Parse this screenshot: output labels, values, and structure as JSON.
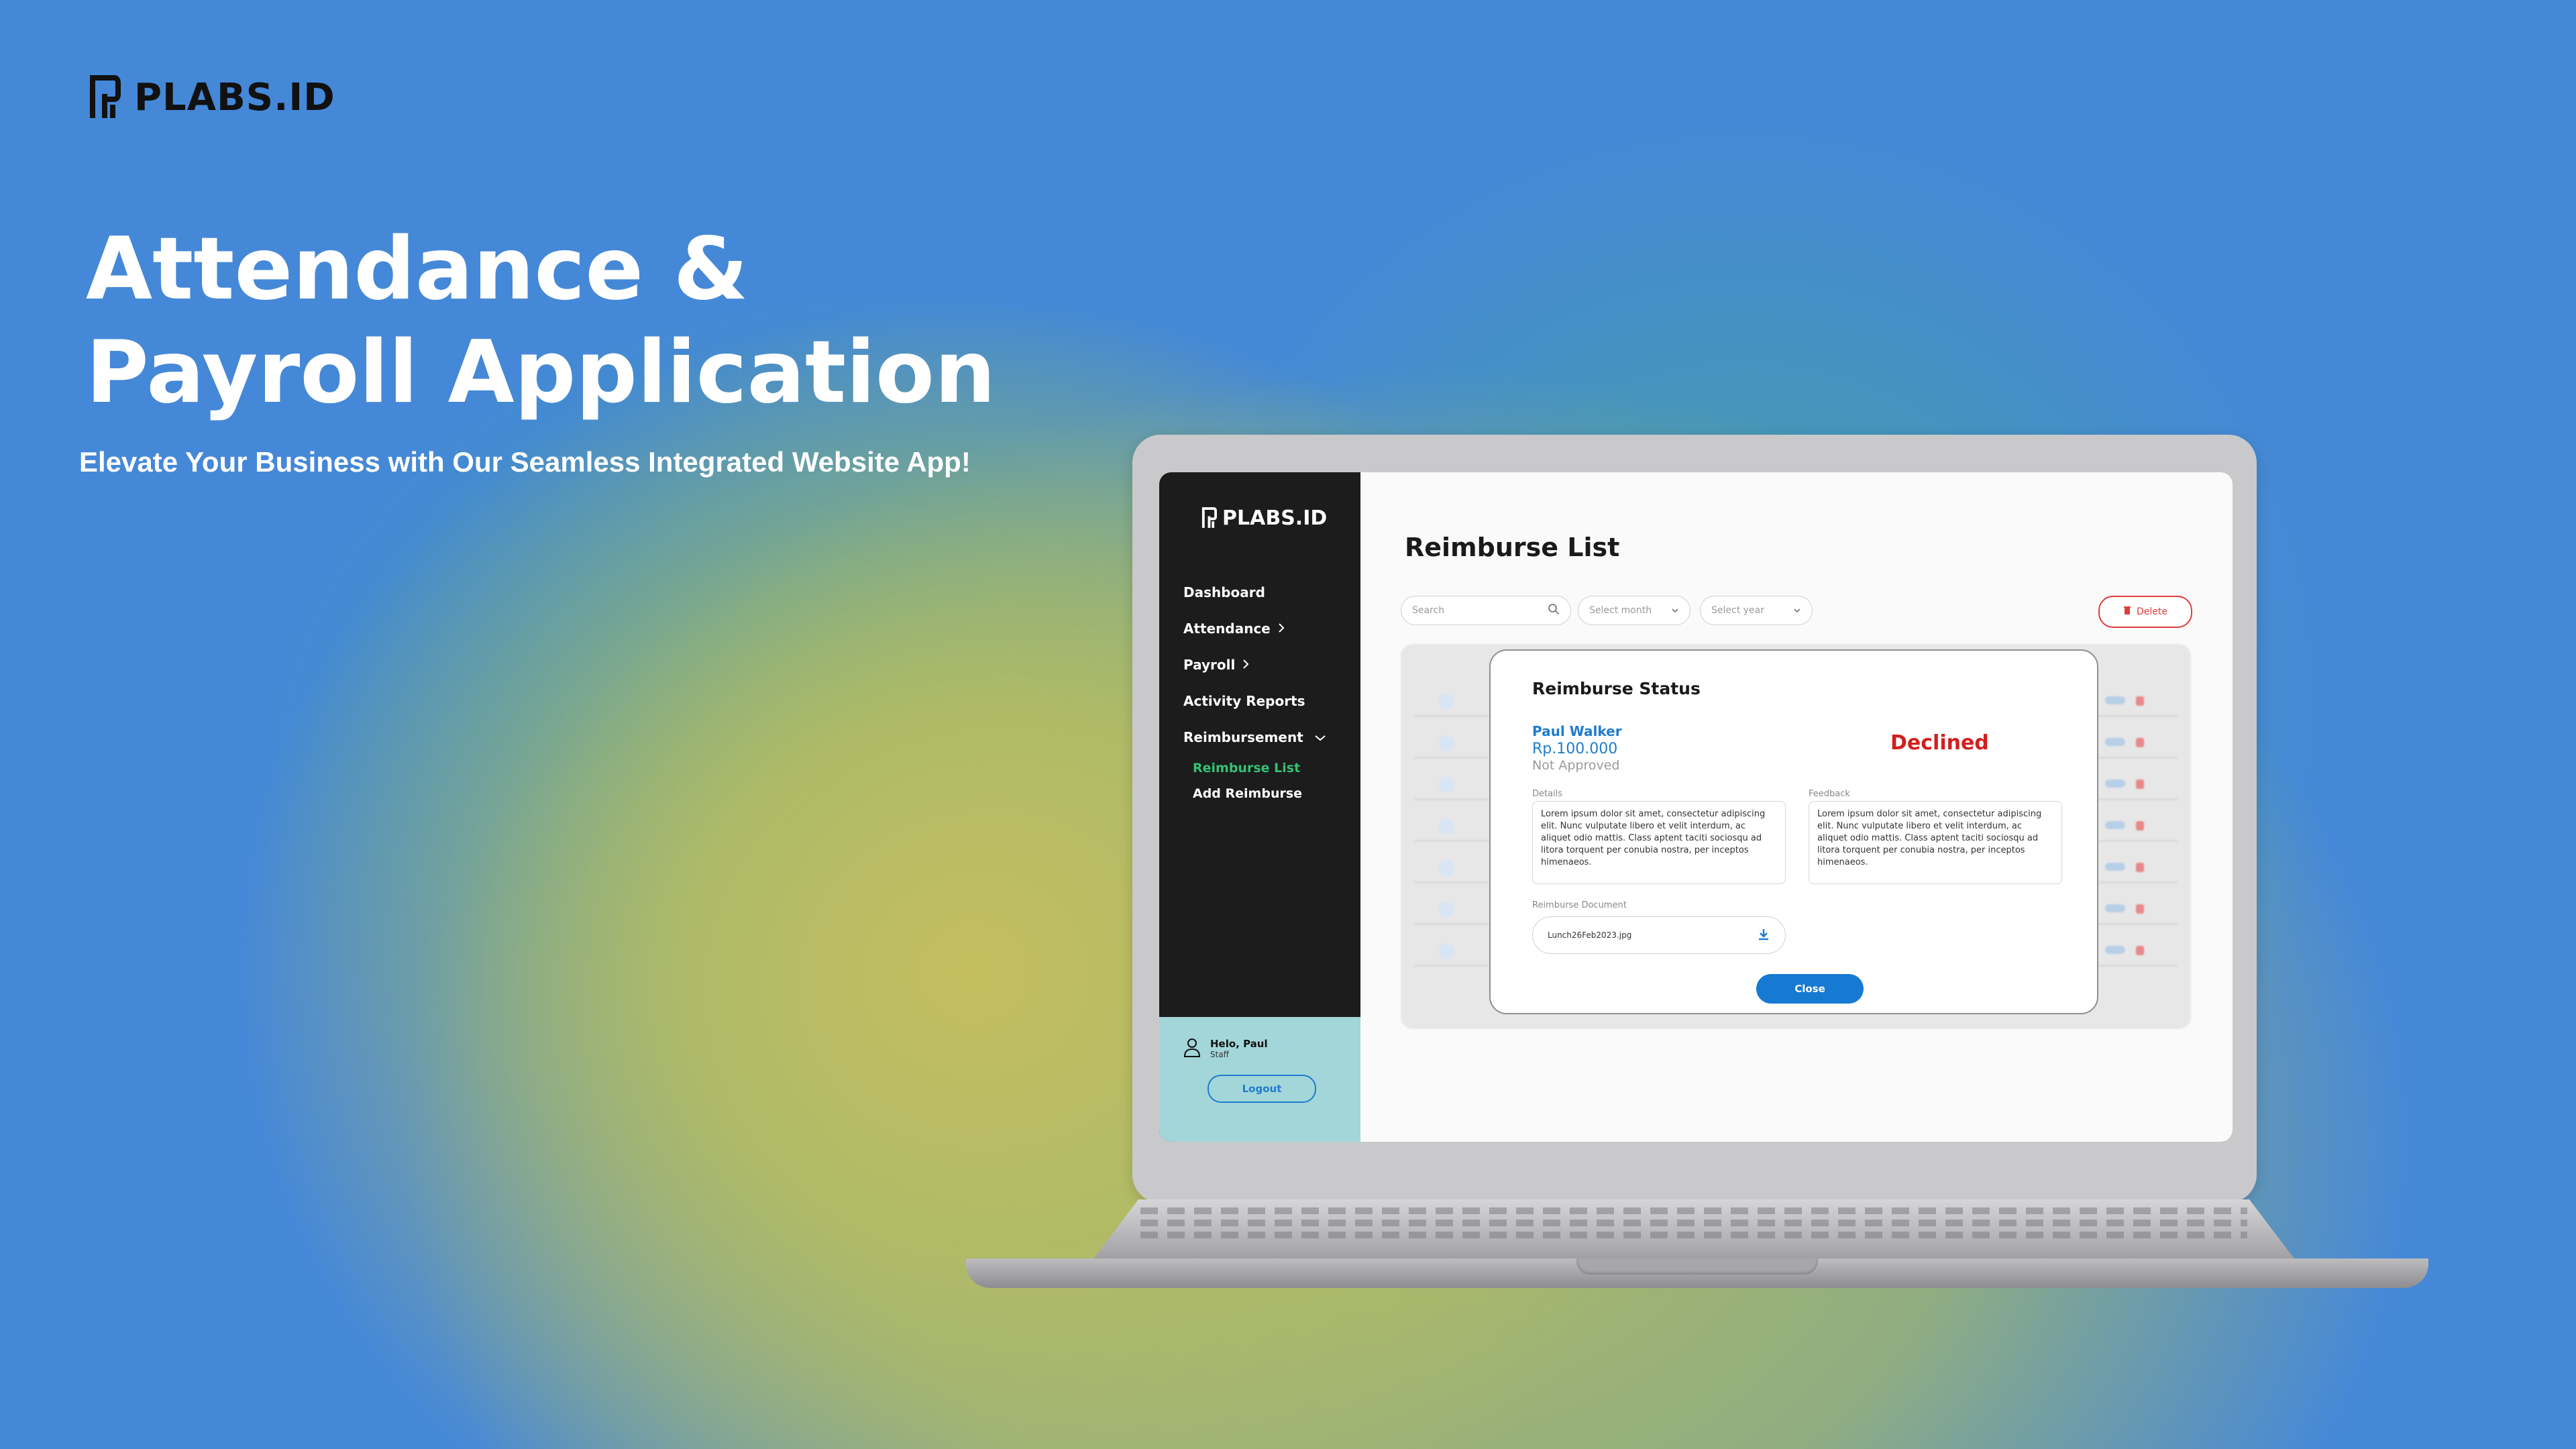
{
  "brand": {
    "name": "PLABS.ID"
  },
  "hero": {
    "title_line1": "Attendance &",
    "title_line2": "Payroll Application",
    "subtitle": "Elevate Your Business with Our Seamless Integrated Website App!"
  },
  "app": {
    "brand": "PLABS.ID",
    "sidebar": {
      "items": [
        {
          "label": "Dashboard",
          "icon": ""
        },
        {
          "label": "Attendance",
          "icon": "chevron-right-icon"
        },
        {
          "label": "Payroll",
          "icon": "chevron-right-icon"
        },
        {
          "label": "Activity Reports",
          "icon": ""
        },
        {
          "label": "Reimbursement",
          "icon": "chevron-down-icon"
        }
      ],
      "subitems": [
        {
          "label": "Reimburse List",
          "active": true
        },
        {
          "label": "Add Reimburse",
          "active": false
        }
      ],
      "user": {
        "greeting": "Helo, Paul",
        "role": "Staff",
        "logout_label": "Logout"
      }
    },
    "main": {
      "title": "Reimburse List",
      "search_placeholder": "Search",
      "month_placeholder": "Select month",
      "year_placeholder": "Select year",
      "delete_label": "Delete"
    },
    "modal": {
      "title": "Reimburse Status",
      "name": "Paul Walker",
      "amount": "Rp.100.000",
      "approval": "Not Approved",
      "status": "Declined",
      "details_label": "Details",
      "details_text": "Lorem ipsum dolor sit amet, consectetur adipiscing elit. Nunc vulputate libero et velit interdum, ac aliquet odio mattis. Class aptent taciti sociosqu ad litora torquent per conubia nostra, per inceptos himenaeos.",
      "feedback_label": "Feedback",
      "feedback_text": "Lorem ipsum dolor sit amet, consectetur adipiscing elit. Nunc vulputate libero et velit interdum, ac aliquet odio mattis. Class aptent taciti sociosqu ad litora torquent per conubia nostra, per inceptos himenaeos.",
      "document_label": "Reimburse Document",
      "document_file": "Lunch26Feb2023.jpg",
      "close_label": "Close"
    }
  },
  "colors": {
    "accent_blue": "#1679d2",
    "declined_red": "#d21f1f",
    "active_green": "#34c174",
    "sidebar_dark": "#1c1c1c",
    "user_panel": "#a3d6d9"
  }
}
